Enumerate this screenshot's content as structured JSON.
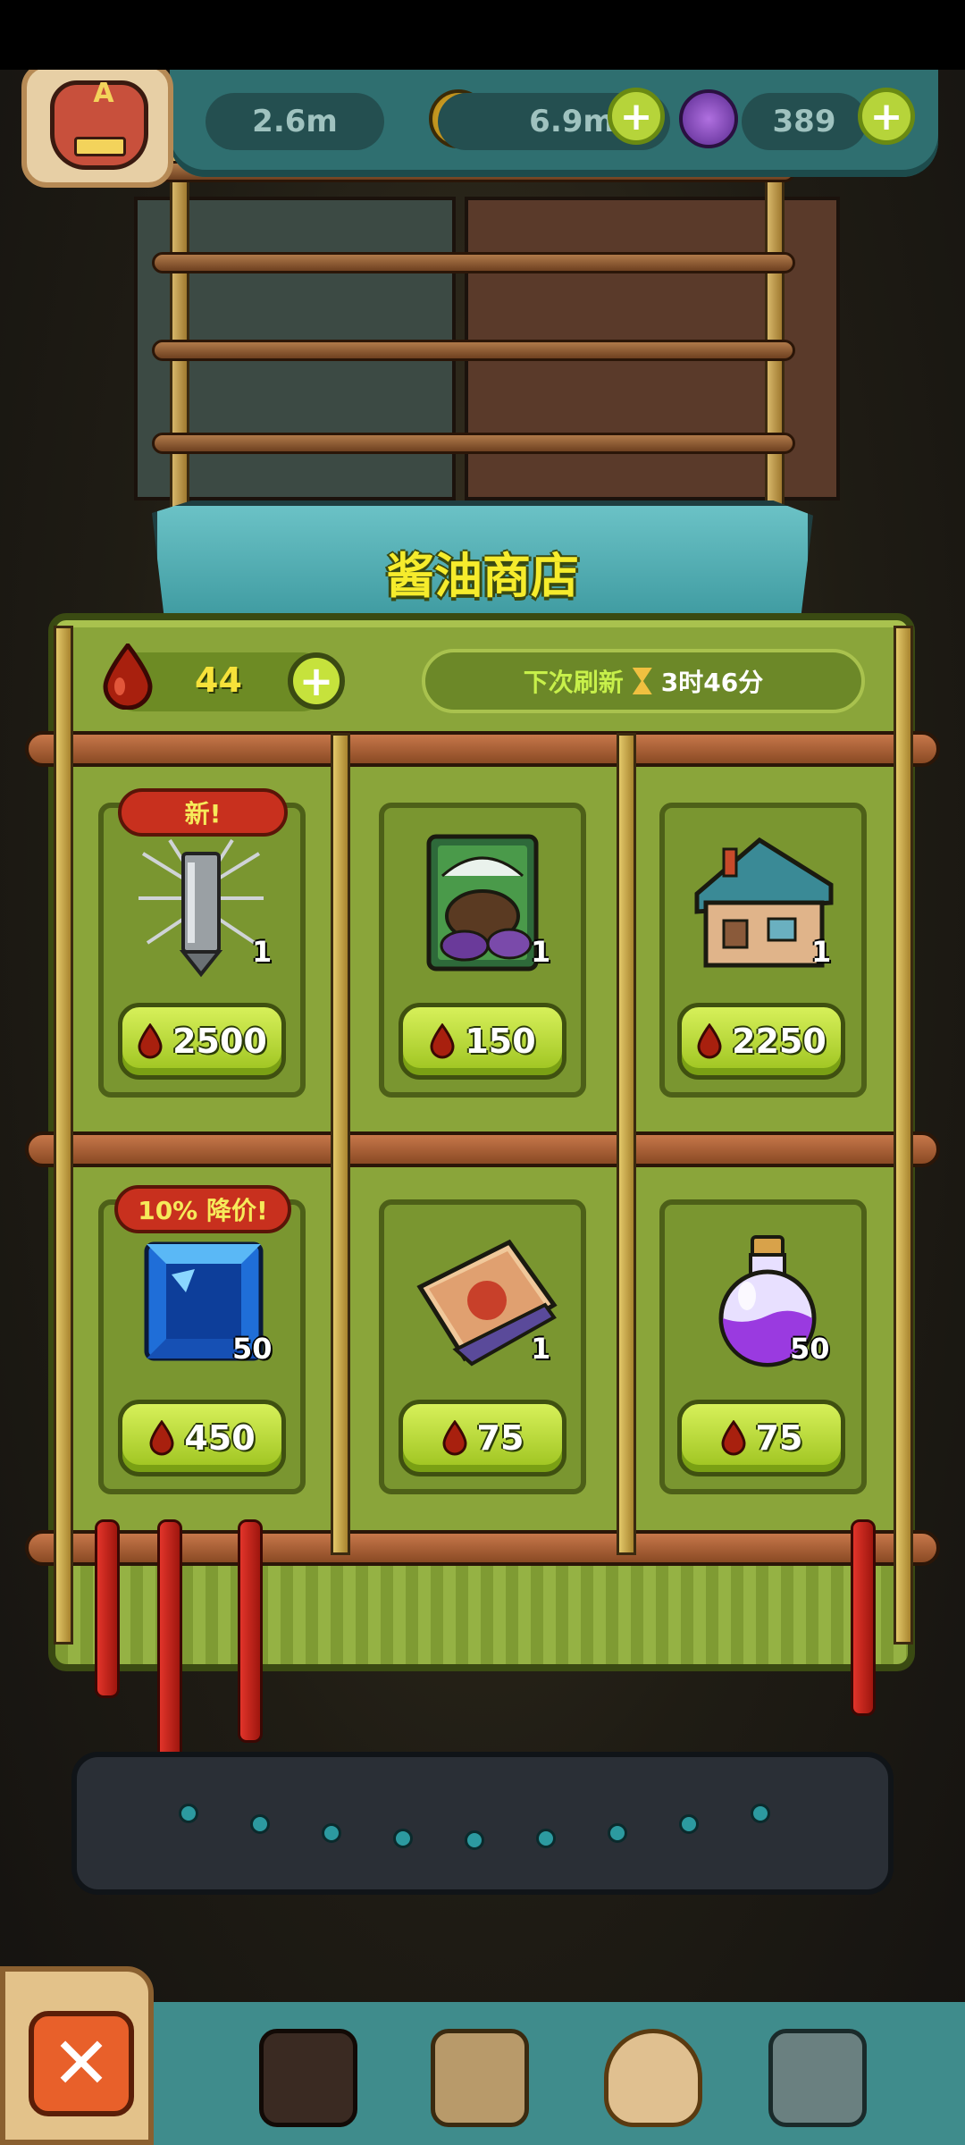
{
  "hud": {
    "currency_1": "2.6m",
    "currency_2": "6.9m",
    "currency_3": "389",
    "avatar_letter": "A"
  },
  "shop": {
    "title": "酱油商店",
    "blood_count": "44",
    "refresh_label": "下次刷新",
    "refresh_time": "3时46分"
  },
  "items": [
    {
      "name": "spiked-weapon",
      "qty": "1",
      "price": "2500",
      "badge": "新!"
    },
    {
      "name": "cauldron-card",
      "qty": "1",
      "price": "150",
      "badge": ""
    },
    {
      "name": "house",
      "qty": "1",
      "price": "2250",
      "badge": ""
    },
    {
      "name": "blue-gem",
      "qty": "50",
      "price": "450",
      "badge": "10% 降价!"
    },
    {
      "name": "scroll",
      "qty": "1",
      "price": "75",
      "badge": ""
    },
    {
      "name": "purple-potion",
      "qty": "50",
      "price": "75",
      "badge": ""
    }
  ],
  "colors": {
    "accent_green": "#9cc21e",
    "badge_red": "#c8301e",
    "title_yellow": "#f6ec2c",
    "panel_green": "#8aa53a"
  }
}
